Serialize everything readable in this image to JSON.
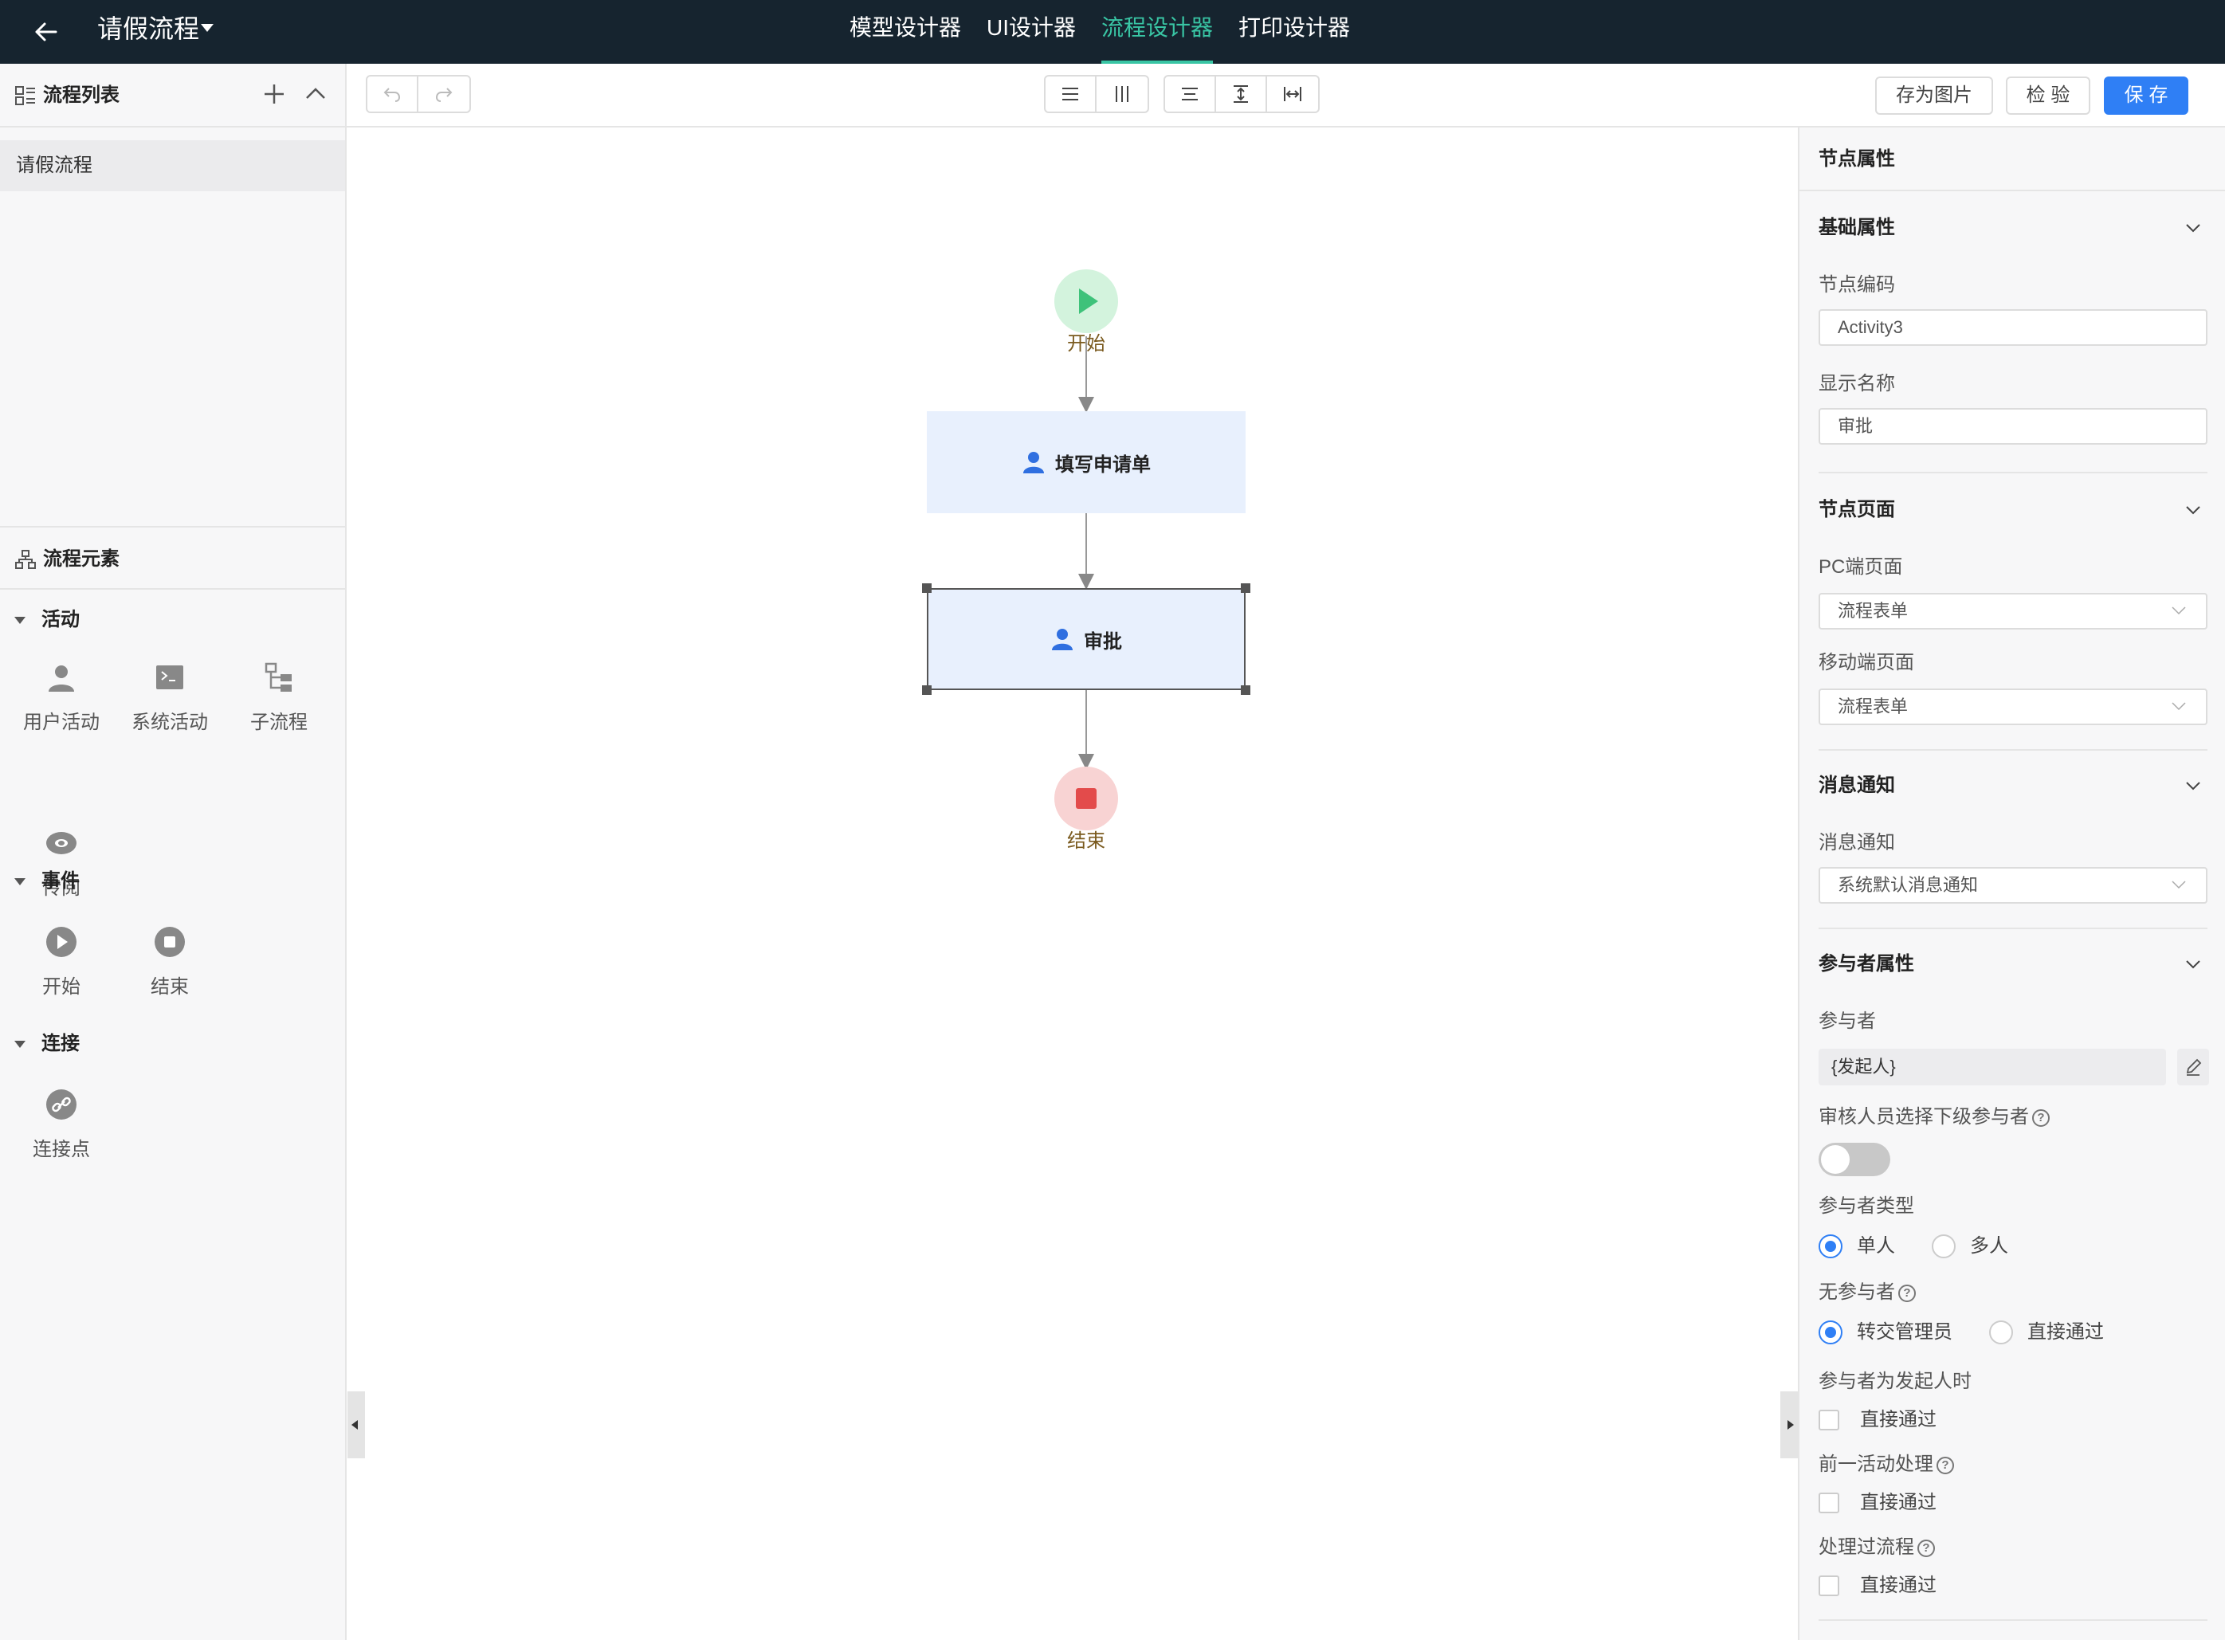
{
  "header": {
    "title": "请假流程",
    "tabs": [
      {
        "label": "模型设计器",
        "active": false
      },
      {
        "label": "UI设计器",
        "active": false
      },
      {
        "label": "流程设计器",
        "active": true
      },
      {
        "label": "打印设计器",
        "active": false
      }
    ]
  },
  "colors": {
    "topbar": "#16242f",
    "accent_tab": "#39c5a4",
    "primary": "#2f7ff5",
    "start_node": "#3ec27a",
    "end_node": "#e34b4b",
    "task_fill": "#e8f0fd"
  },
  "left_panel": {
    "flow_list_title": "流程列表",
    "flows": [
      "请假流程"
    ],
    "elements_title": "流程元素",
    "sections": [
      {
        "title": "活动",
        "items": [
          {
            "label": "用户活动",
            "icon": "user-icon"
          },
          {
            "label": "系统活动",
            "icon": "terminal-icon"
          },
          {
            "label": "子流程",
            "icon": "subprocess-icon"
          },
          {
            "label": "传阅",
            "icon": "eye-icon"
          }
        ]
      },
      {
        "title": "事件",
        "items": [
          {
            "label": "开始",
            "icon": "play-circle-icon"
          },
          {
            "label": "结束",
            "icon": "stop-circle-icon"
          }
        ]
      },
      {
        "title": "连接",
        "items": [
          {
            "label": "连接点",
            "icon": "link-icon"
          }
        ]
      }
    ]
  },
  "toolbar": {
    "save_image": "存为图片",
    "check": "检 验",
    "save": "保 存"
  },
  "canvas": {
    "start_label": "开始",
    "end_label": "结束",
    "tasks": [
      {
        "label": "填写申请单",
        "selected": false
      },
      {
        "label": "审批",
        "selected": true
      }
    ]
  },
  "properties": {
    "title": "节点属性",
    "basic": {
      "title": "基础属性",
      "code_label": "节点编码",
      "code_value": "Activity3",
      "name_label": "显示名称",
      "name_value": "审批"
    },
    "page": {
      "title": "节点页面",
      "pc_label": "PC端页面",
      "pc_value": "流程表单",
      "mobile_label": "移动端页面",
      "mobile_value": "流程表单"
    },
    "notify": {
      "title": "消息通知",
      "label": "消息通知",
      "value": "系统默认消息通知"
    },
    "participant": {
      "title": "参与者属性",
      "label": "参与者",
      "value": "{发起人}",
      "sub_select_label": "审核人员选择下级参与者",
      "sub_select_on": false,
      "type_label": "参与者类型",
      "type_options": [
        "单人",
        "多人"
      ],
      "type_selected": "单人",
      "none_label": "无参与者",
      "none_options": [
        "转交管理员",
        "直接通过"
      ],
      "none_selected": "转交管理员",
      "initiator_label": "参与者为发起人时",
      "initiator_option": "直接通过",
      "prev_label": "前一活动处理",
      "prev_option": "直接通过",
      "processed_label": "处理过流程",
      "processed_option": "直接通过"
    }
  }
}
